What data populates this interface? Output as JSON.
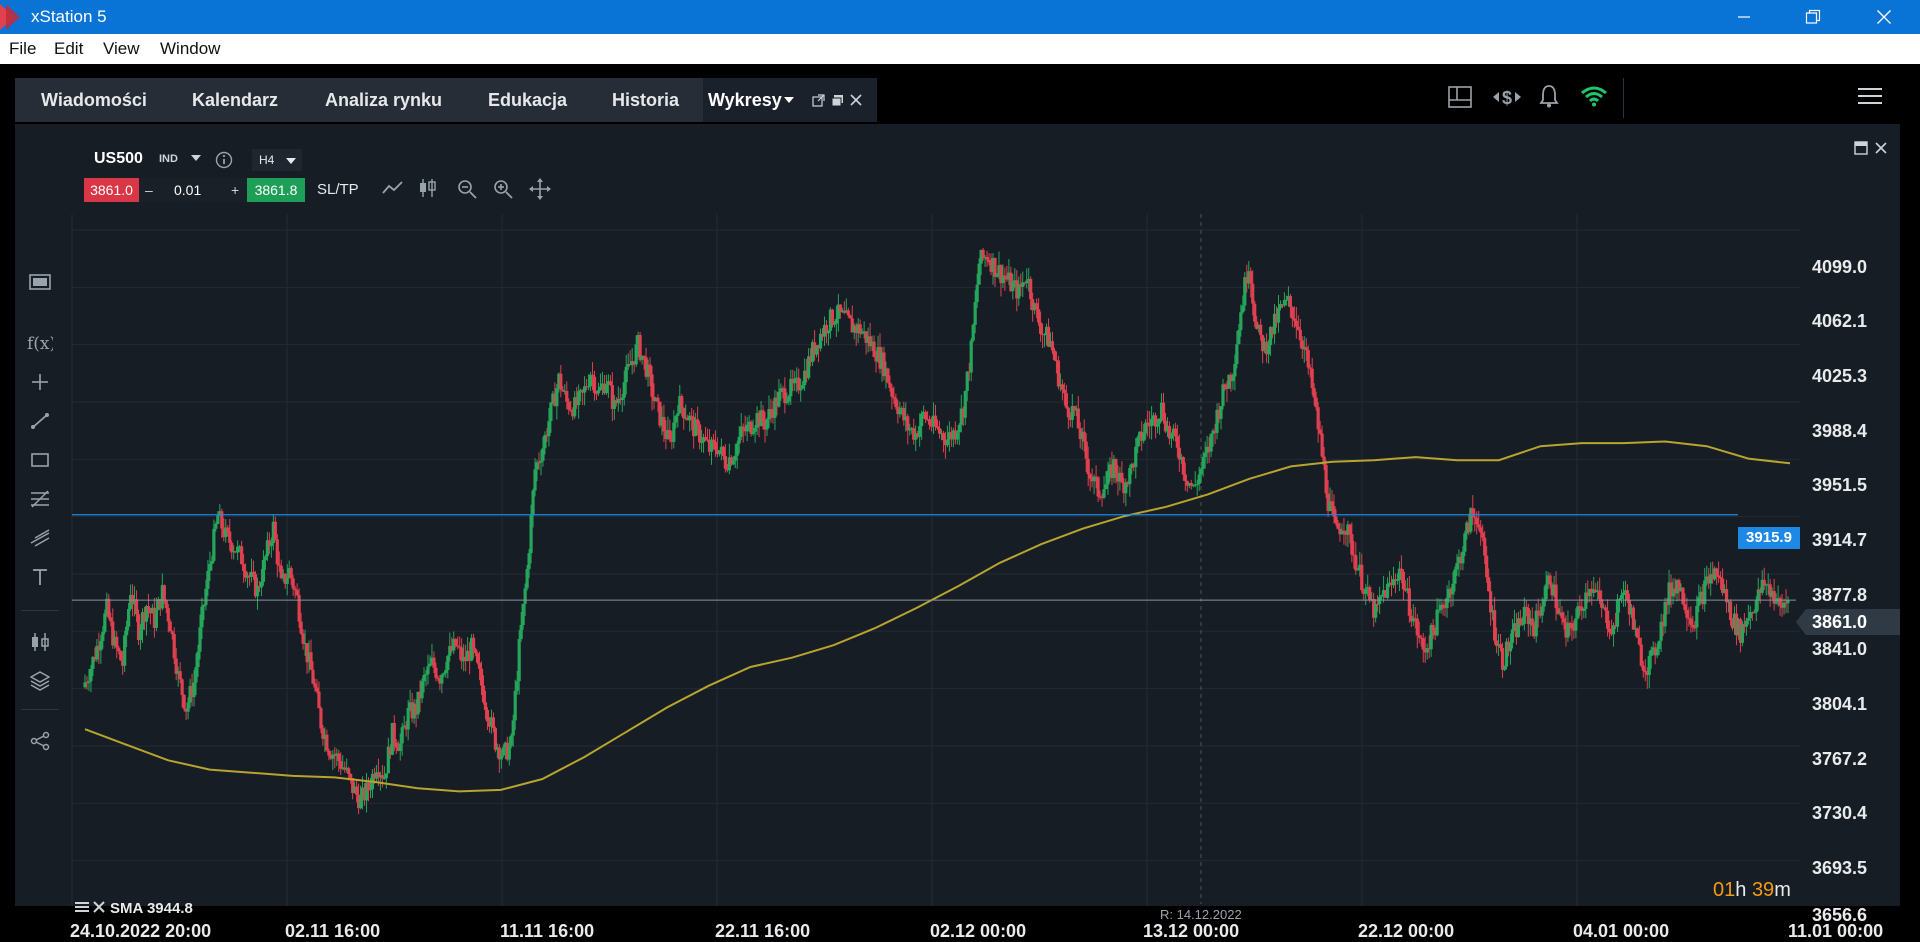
{
  "window": {
    "title": "xStation 5",
    "minimize_glyph": "—",
    "restore_glyph": "❐",
    "close_glyph": "✕"
  },
  "menubar": [
    "File",
    "Edit",
    "View",
    "Window"
  ],
  "tabs": [
    {
      "label": "Wiadomości"
    },
    {
      "label": "Kalendarz"
    },
    {
      "label": "Analiza rynku"
    },
    {
      "label": "Edukacja"
    },
    {
      "label": "Historia"
    },
    {
      "label": "Wykresy",
      "active": true
    }
  ],
  "chart_header": {
    "symbol": "US500",
    "instrument_type": "IND",
    "timeframe": "H4",
    "sell_price": "3861.0",
    "volume": "0.01",
    "minus": "–",
    "plus": "+",
    "buy_price": "3861.8",
    "sltp": "SL/TP"
  },
  "indicator_label": "SMA 3944.8",
  "crosshair_date": "R: 14.12.2022",
  "countdown": {
    "hours": "01",
    "h": "h",
    "minutes": "39",
    "m": "m"
  },
  "hline_price": "3915.9",
  "current_price_tag": "3861.0",
  "colors": {
    "up": "#26a65b",
    "down": "#e0404f",
    "sma": "#b8a42e",
    "hline": "#1e88e5",
    "price_line": "#8a949e",
    "countdown": "#f39c12"
  },
  "chart_data": {
    "type": "candlestick",
    "symbol": "US500",
    "timeframe": "H4",
    "y_ticks": [
      "4099.0",
      "4062.1",
      "4025.3",
      "3988.4",
      "3951.5",
      "3914.7",
      "3877.8",
      "3841.0",
      "3804.1",
      "3767.2",
      "3730.4",
      "3693.5",
      "3656.6"
    ],
    "ylim": [
      3656.6,
      4099.0
    ],
    "x_ticks": [
      "24.10.2022 20:00",
      "02.11 16:00",
      "11.11 16:00",
      "22.11 16:00",
      "02.12 00:00",
      "13.12 00:00",
      "22.12 00:00",
      "04.01 00:00",
      "11.01 00:00"
    ],
    "close_path": [
      3805,
      3818,
      3835,
      3855,
      3832,
      3820,
      3868,
      3842,
      3858,
      3848,
      3866,
      3846,
      3812,
      3792,
      3808,
      3850,
      3885,
      3915,
      3902,
      3896,
      3888,
      3876,
      3867,
      3888,
      3908,
      3870,
      3880,
      3862,
      3831,
      3810,
      3782,
      3766,
      3760,
      3752,
      3740,
      3732,
      3740,
      3756,
      3748,
      3775,
      3768,
      3788,
      3791,
      3810,
      3820,
      3812,
      3825,
      3832,
      3821,
      3830,
      3812,
      3790,
      3770,
      3761,
      3768,
      3830,
      3880,
      3945,
      3960,
      3982,
      4003,
      3988,
      3985,
      3992,
      4008,
      3994,
      4003,
      3985,
      3998,
      4012,
      4025,
      4011,
      3990,
      3975,
      3961,
      3988,
      3982,
      3972,
      3966,
      3958,
      3960,
      3950,
      3955,
      3968,
      3972,
      3979,
      3975,
      3985,
      3993,
      3996,
      3998,
      4007,
      4021,
      4032,
      4040,
      4045,
      4042,
      4037,
      4035,
      4028,
      4021,
      4012,
      3995,
      3983,
      3972,
      3968,
      3980,
      3974,
      3969,
      3965,
      3970,
      3985,
      4022,
      4078,
      4083,
      4075,
      4070,
      4064,
      4059,
      4071,
      4048,
      4034,
      4027,
      4005,
      3985,
      3982,
      3963,
      3942,
      3931,
      3935,
      3948,
      3935,
      3942,
      3960,
      3973,
      3977,
      3985,
      3967,
      3962,
      3942,
      3932,
      3945,
      3959,
      3980,
      3998,
      4010,
      4047,
      4079,
      4034,
      4023,
      4035,
      4048,
      4052,
      4041,
      4023,
      3997,
      3964,
      3925,
      3905,
      3912,
      3895,
      3878,
      3863,
      3852,
      3866,
      3870,
      3882,
      3862,
      3845,
      3828,
      3838,
      3852,
      3864,
      3878,
      3895,
      3915,
      3914,
      3875,
      3842,
      3822,
      3834,
      3845,
      3852,
      3844,
      3860,
      3876,
      3855,
      3838,
      3846,
      3858,
      3872,
      3862,
      3850,
      3842,
      3868,
      3858,
      3832,
      3818,
      3824,
      3845,
      3866,
      3873,
      3860,
      3846,
      3862,
      3875,
      3879,
      3865,
      3849,
      3840,
      3852,
      3860,
      3872,
      3866,
      3855,
      3862
    ],
    "sma_series": {
      "name": "SMA",
      "last_value": 3944.8,
      "path": [
        3778,
        3768,
        3758,
        3752,
        3750,
        3748,
        3747,
        3744,
        3740,
        3738,
        3739,
        3746,
        3760,
        3776,
        3792,
        3806,
        3818,
        3824,
        3832,
        3843,
        3856,
        3870,
        3885,
        3897,
        3907,
        3915,
        3921,
        3929,
        3939,
        3947,
        3950,
        3951,
        3953,
        3951,
        3951,
        3960,
        3962,
        3962,
        3963,
        3960,
        3952,
        3949
      ]
    },
    "horizontal_line": {
      "label": "3915.9",
      "value": 3915.9
    },
    "current_price": {
      "value": 3861.0,
      "label": "3861.0"
    },
    "grid": true,
    "legend": "bottom-left"
  }
}
